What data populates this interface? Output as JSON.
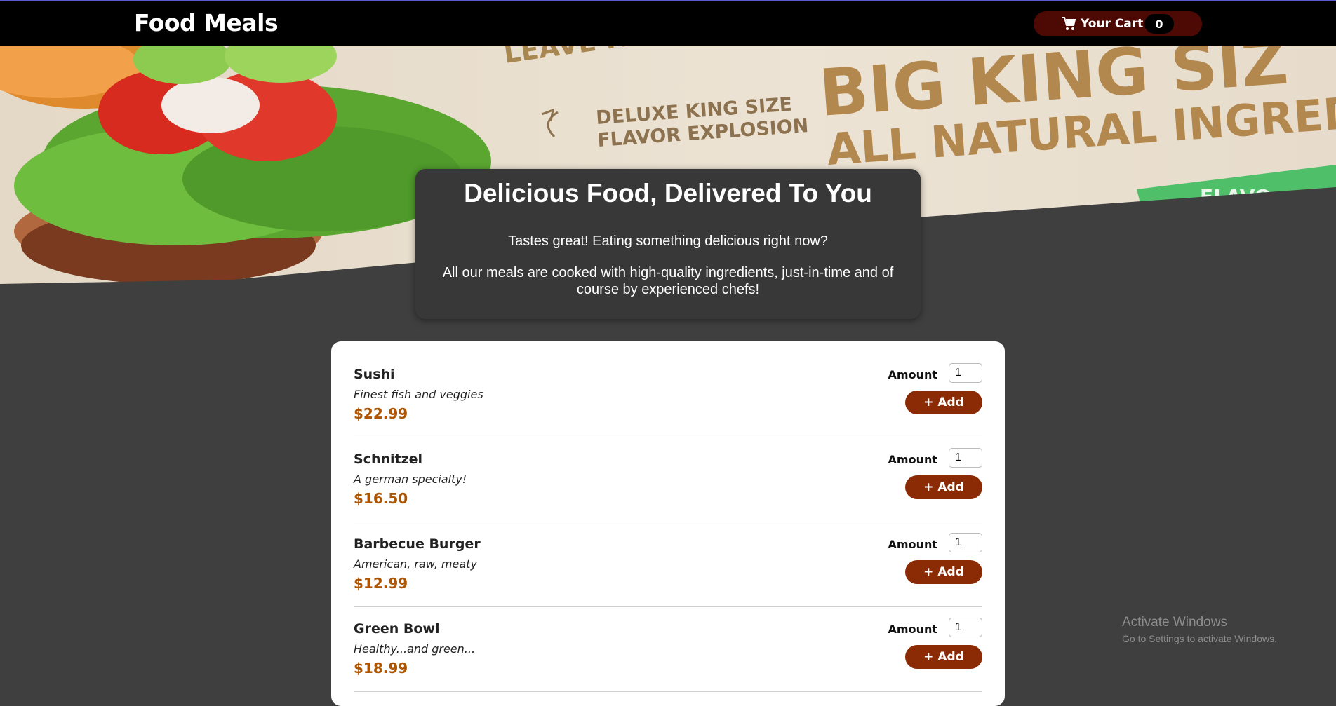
{
  "header": {
    "brand": "Food Meals",
    "cart_label": "Your Cart",
    "cart_count": "0",
    "cart_icon": "shopping-cart-icon"
  },
  "hero": {
    "banner_text_1": "LEAVE IT",
    "banner_text_2": "DELUXE KING SIZE",
    "banner_text_3": "FLAVOR EXPLOSION",
    "banner_text_4": "BIG KING SIZ",
    "banner_text_5": "ALL NATURAL INGREDIEN",
    "banner_text_6": "FLAVO"
  },
  "summary": {
    "title": "Delicious Food, Delivered To You",
    "line1": "Tastes great! Eating something delicious right now?",
    "line2": "All our meals are cooked with high-quality ingredients, just-in-time and of course by experienced chefs!"
  },
  "meals": [
    {
      "name": "Sushi",
      "description": "Finest fish and veggies",
      "price": "$22.99",
      "amount_label": "Amount",
      "amount": "1",
      "add_label": "+ Add"
    },
    {
      "name": "Schnitzel",
      "description": "A german specialty!",
      "price": "$16.50",
      "amount_label": "Amount",
      "amount": "1",
      "add_label": "+ Add"
    },
    {
      "name": "Barbecue Burger",
      "description": "American, raw, meaty",
      "price": "$12.99",
      "amount_label": "Amount",
      "amount": "1",
      "add_label": "+ Add"
    },
    {
      "name": "Green Bowl",
      "description": "Healthy...and green...",
      "price": "$18.99",
      "amount_label": "Amount",
      "amount": "1",
      "add_label": "+ Add"
    }
  ],
  "watermark": {
    "line1": "Activate Windows",
    "line2": "Go to Settings to activate Windows."
  },
  "colors": {
    "header_bg": "#000000",
    "cart_bg": "#4d0a05",
    "add_button": "#8a2b06",
    "price": "#ad5502",
    "page_bg": "#3f3f3f"
  }
}
